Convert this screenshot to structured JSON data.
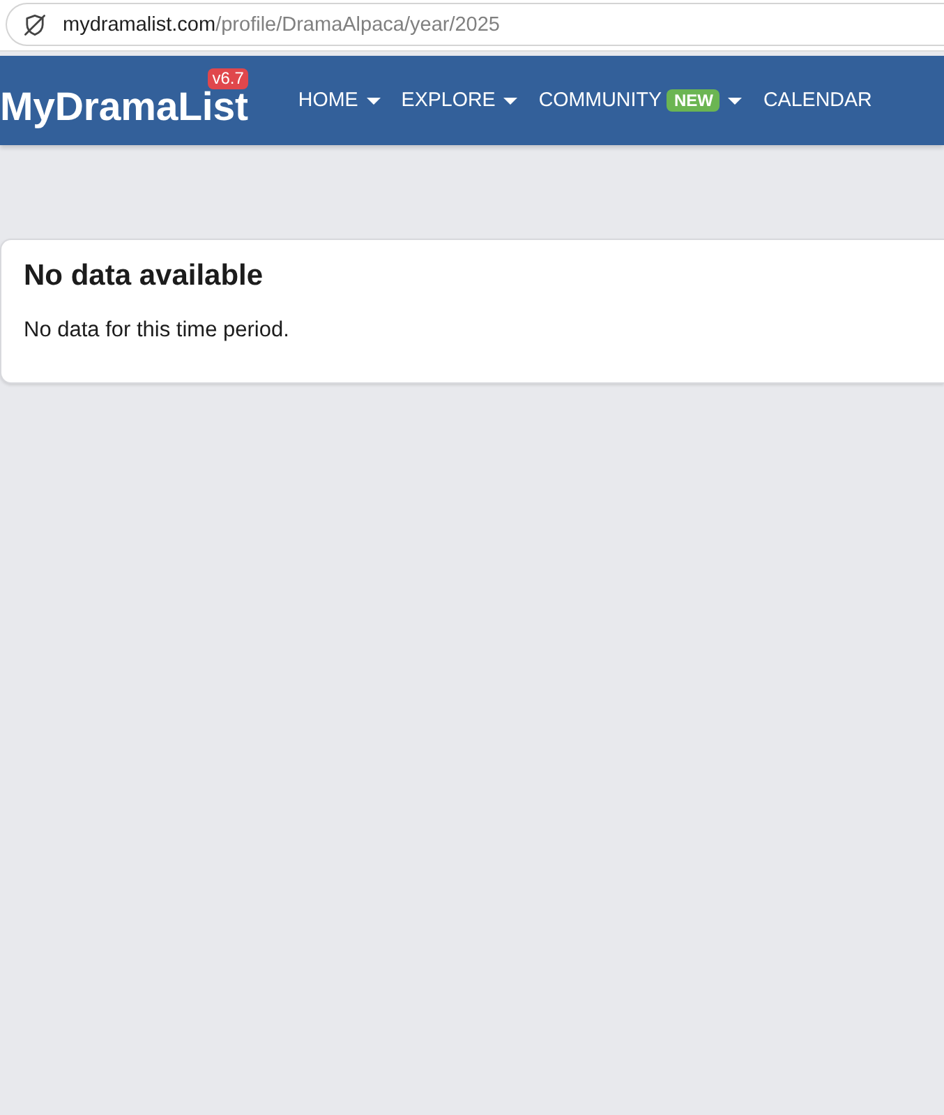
{
  "browser": {
    "url": {
      "host": "mydramalist.com",
      "path": "/profile/DramaAlpaca/year/2025"
    }
  },
  "navbar": {
    "logo": "MyDramaList",
    "version_badge": "v6.7",
    "items": [
      {
        "label": "HOME",
        "kind": "dropdown"
      },
      {
        "label": "EXPLORE",
        "kind": "dropdown"
      },
      {
        "label": "COMMUNITY",
        "badge": "NEW",
        "kind": "dropdown"
      },
      {
        "label": "CALENDAR",
        "kind": "link"
      }
    ]
  },
  "card": {
    "title": "No data available",
    "message": "No data for this time period."
  }
}
